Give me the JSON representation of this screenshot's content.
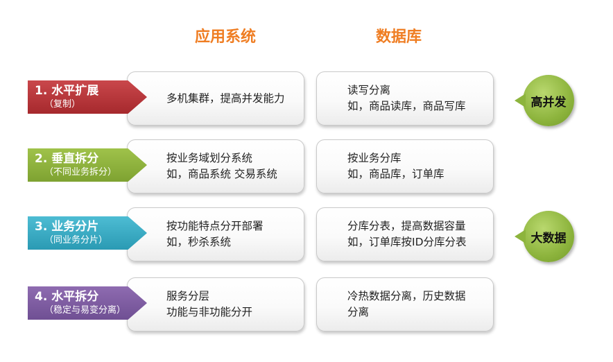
{
  "headers": {
    "app_system": "应用系统",
    "database": "数据库"
  },
  "rows": [
    {
      "tag_title": "1. 水平扩展",
      "tag_sub": "（复制）",
      "tag_color": "#b5353a",
      "app_lines": [
        "多机集群，提高并发能力"
      ],
      "db_lines": [
        "读写分离",
        "如，商品读库，商品写库"
      ]
    },
    {
      "tag_title": "2. 垂直拆分",
      "tag_sub": "（不同业务拆分）",
      "tag_color": "#8cb23b",
      "app_lines": [
        "按业务域划分系统",
        "如，商品系统 交易系统"
      ],
      "db_lines": [
        "按业务分库",
        "如，商品库，订单库"
      ]
    },
    {
      "tag_title": "3. 业务分片",
      "tag_sub": "（同业务分片）",
      "tag_color": "#36a9c2",
      "app_lines": [
        "按功能特点分开部署",
        "如，秒杀系统"
      ],
      "db_lines": [
        "分库分表，提高数据容量",
        "如，订单库按ID分库分表"
      ]
    },
    {
      "tag_title": "4. 水平拆分",
      "tag_sub": "（稳定与易变分离）",
      "tag_color": "#7c5ba0",
      "app_lines": [
        "服务分层",
        "功能与非功能分开"
      ],
      "db_lines": [
        "冷热数据分离，历史数据",
        "分离"
      ]
    }
  ],
  "badges": {
    "high_concurrency": "高并发",
    "big_data": "大数据",
    "color": "#8db43d"
  }
}
